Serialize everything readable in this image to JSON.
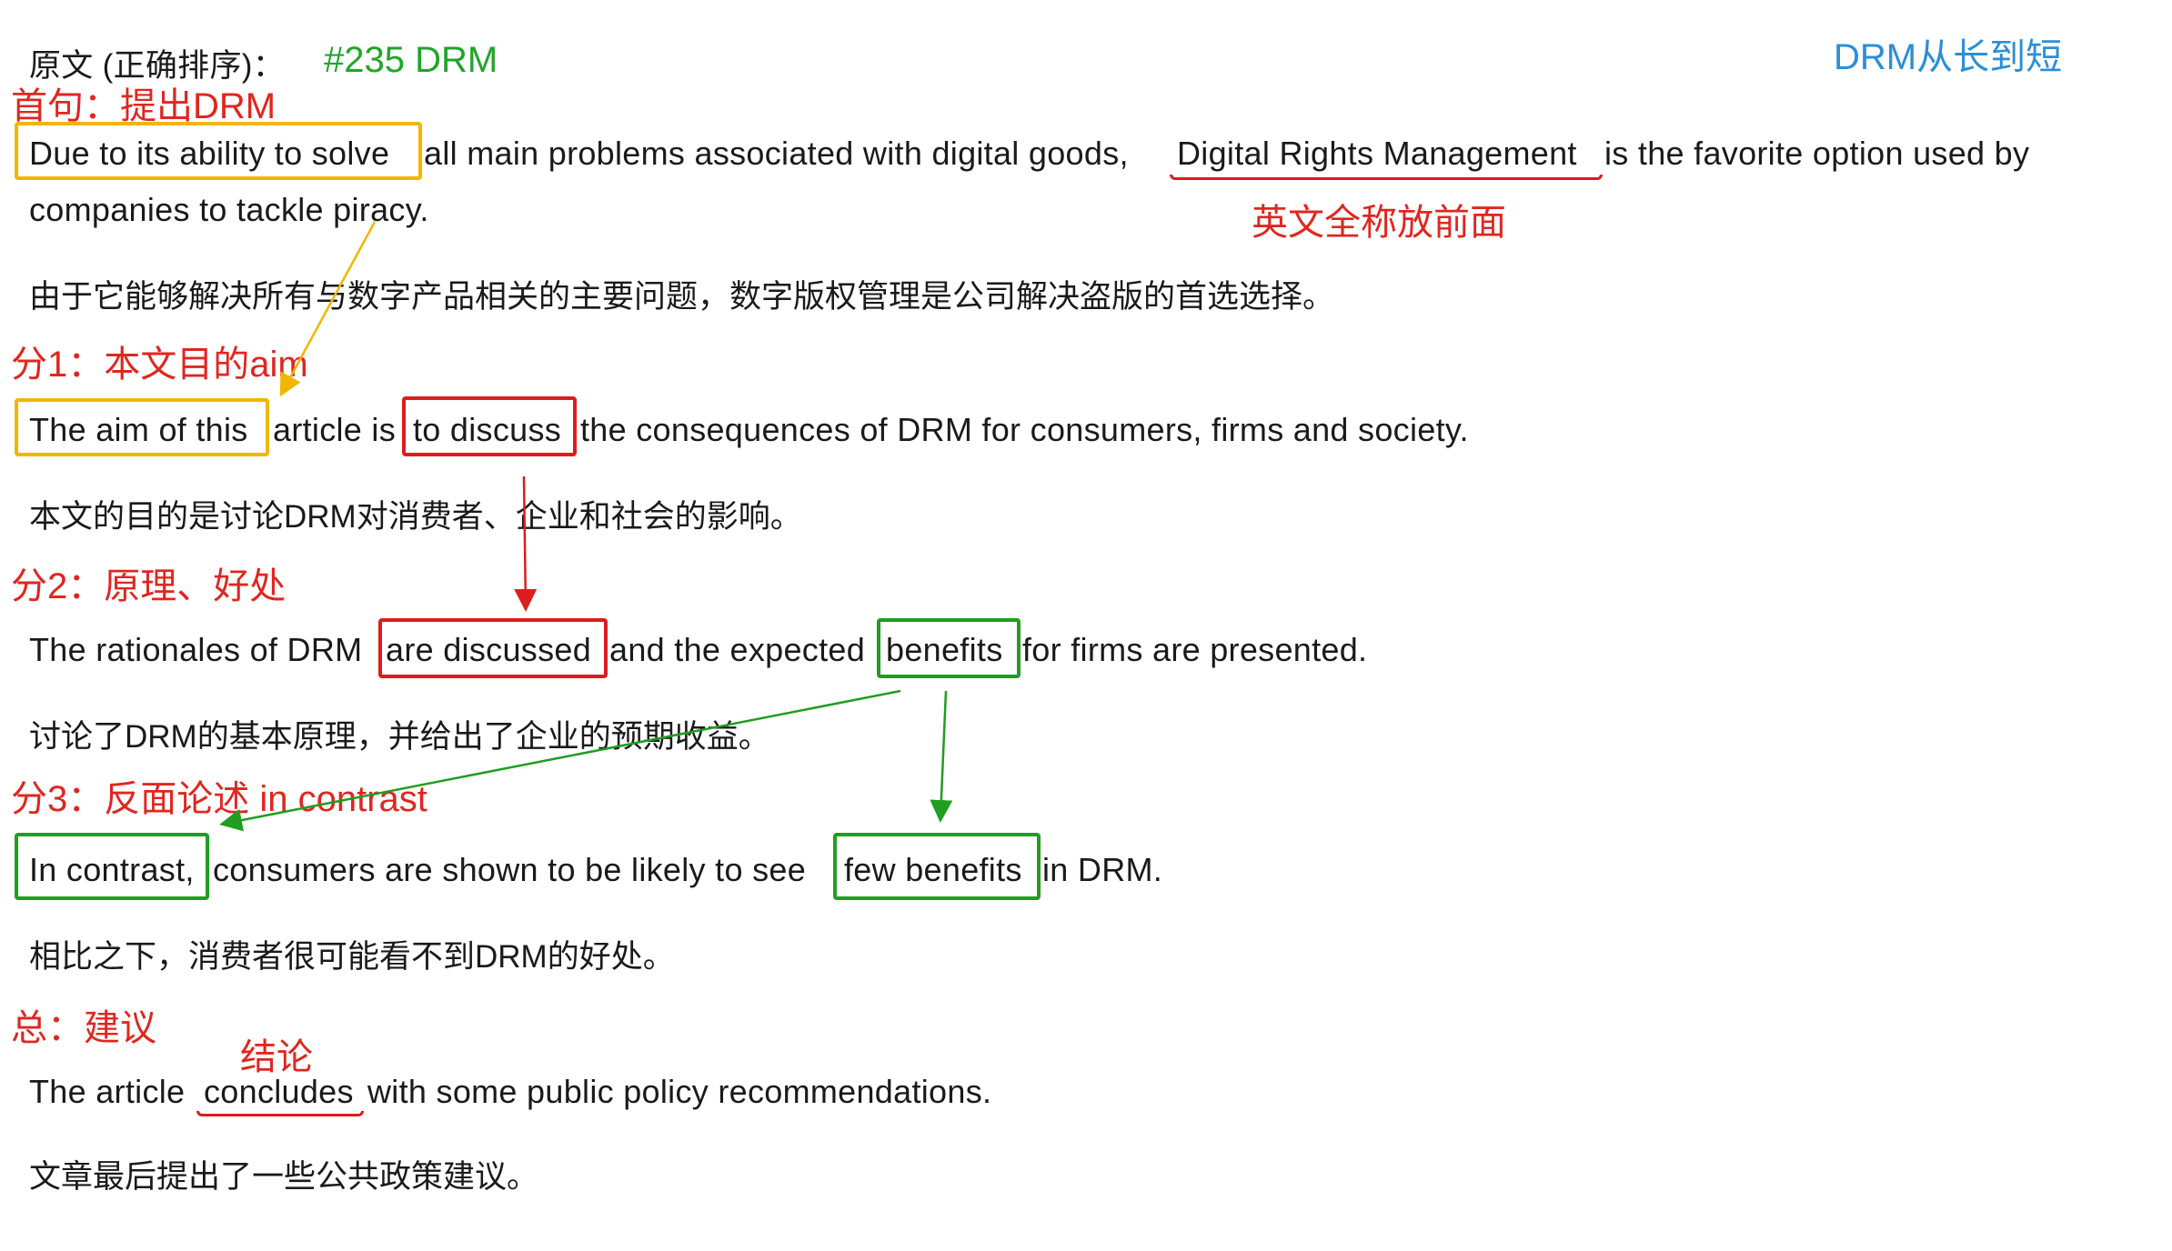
{
  "header": {
    "label": "原文 (正确排序)：",
    "tag": "#235 DRM",
    "note": "DRM从长到短"
  },
  "sections": [
    {
      "heading": "首句：提出DRM",
      "english": {
        "line1_box": "Due to its ability to solve",
        "line1_rest": "all main problems associated with digital goods,",
        "line1_underlined": "Digital Rights Management",
        "line1_tail": "is the favorite option used by",
        "line2": "companies to tackle piracy."
      },
      "annotation": "英文全称放前面",
      "chinese": "由于它能够解决所有与数字产品相关的主要问题，数字版权管理是公司解决盗版的首选选择。"
    },
    {
      "heading": "分1：本文目的aim",
      "english": {
        "box1": "The aim of this",
        "mid": "article is",
        "box2": "to discuss",
        "rest": "the consequences of DRM for consumers, firms and society."
      },
      "chinese": "本文的目的是讨论DRM对消费者、企业和社会的影响。"
    },
    {
      "heading": "分2：原理、好处",
      "english": {
        "pre": "The rationales of DRM",
        "box1": "are discussed",
        "mid": "and the expected",
        "box2": "benefits",
        "rest": "for firms are presented."
      },
      "chinese": "讨论了DRM的基本原理，并给出了企业的预期收益。"
    },
    {
      "heading": "分3：反面论述 in contrast",
      "english": {
        "box1": "In contrast,",
        "mid": "consumers are shown to be likely to see",
        "box2": "few benefits",
        "rest": "in DRM."
      },
      "chinese": "相比之下，消费者很可能看不到DRM的好处。"
    },
    {
      "heading": "总：建议",
      "annotation": "结论",
      "english": {
        "pre": "The article",
        "underlined": "concludes",
        "rest": "with some public policy recommendations."
      },
      "chinese": "文章最后提出了一些公共政策建议。"
    }
  ],
  "colors": {
    "red": "#e0261f",
    "green": "#1fa52a",
    "yellow": "#f2b600",
    "blue": "#2b8fd6"
  }
}
